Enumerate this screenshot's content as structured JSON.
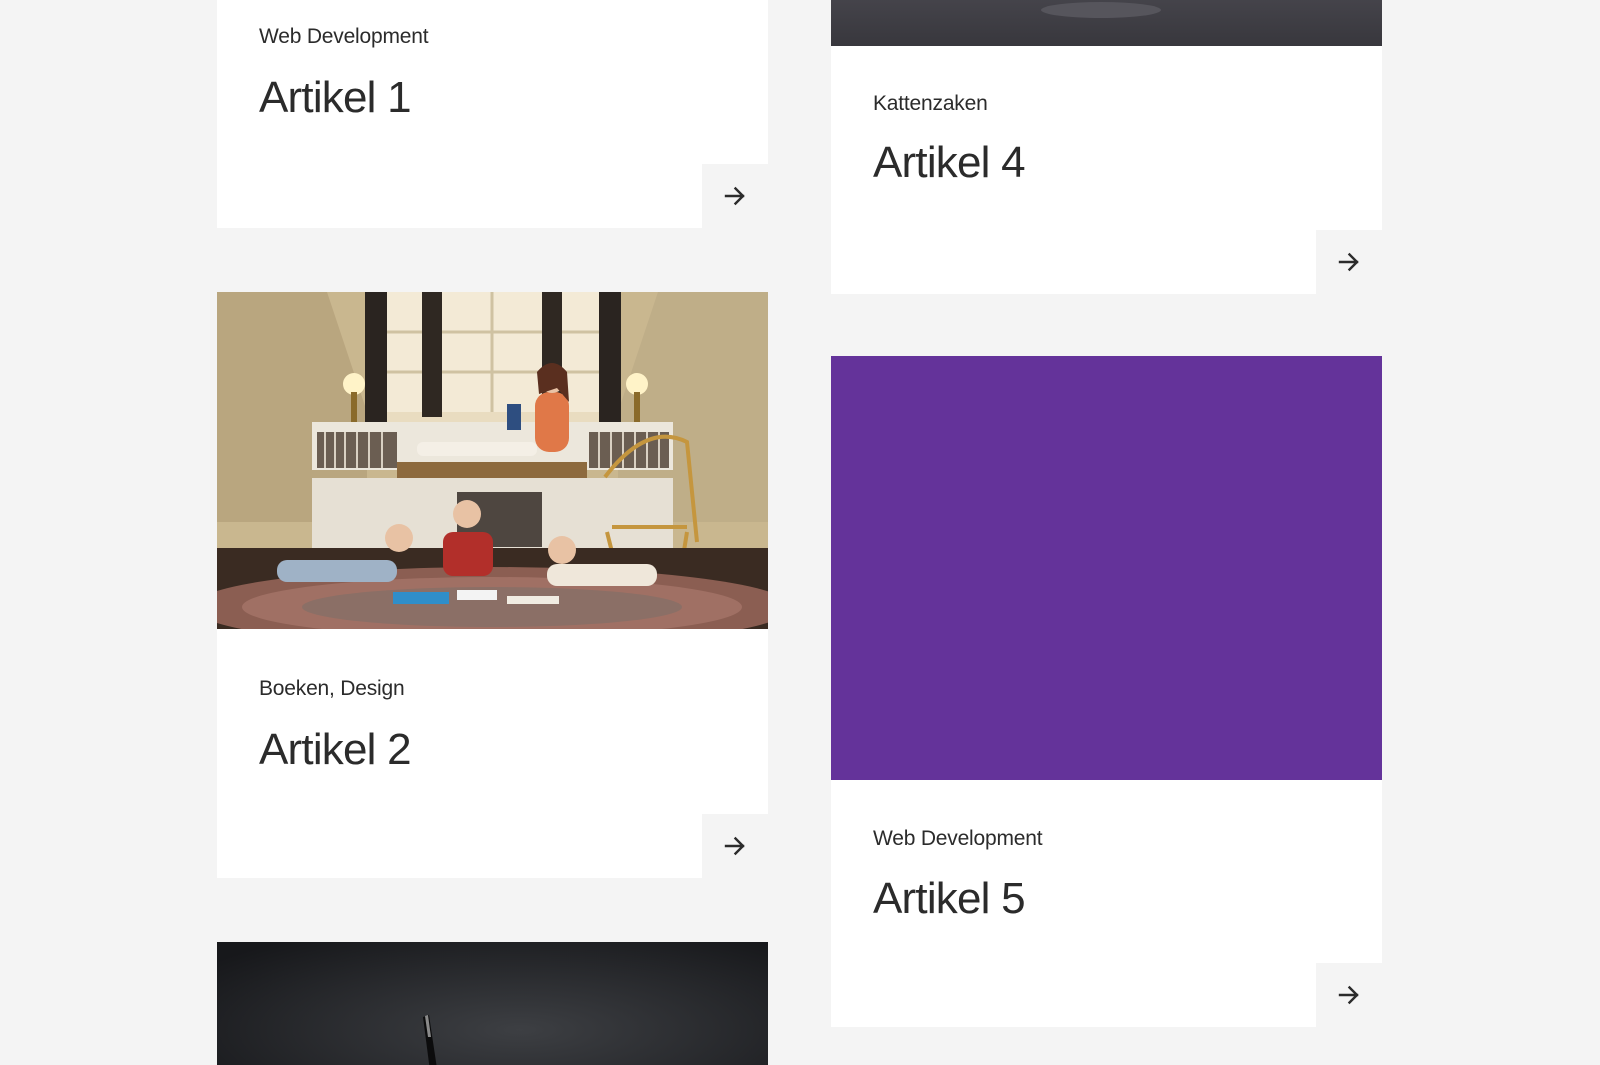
{
  "colors": {
    "page_background": "#f4f4f4",
    "card_background": "#ffffff",
    "text": "#2b2b2b",
    "card5_color_block": "#64339a"
  },
  "cards": [
    {
      "category": "Web Development",
      "title": "Artikel 1",
      "arrow_icon": "arrow-right-icon"
    },
    {
      "category": "Boeken, Design",
      "title": "Artikel 2",
      "image": "photo-reading-room",
      "arrow_icon": "arrow-right-icon"
    },
    {
      "image": "photo-dark-pen"
    },
    {
      "category": "Kattenzaken",
      "title": "Artikel 4",
      "image": "photo-dark-gray",
      "arrow_icon": "arrow-right-icon"
    },
    {
      "category": "Web Development",
      "title": "Artikel 5",
      "image": "purple-color-block",
      "arrow_icon": "arrow-right-icon"
    }
  ]
}
